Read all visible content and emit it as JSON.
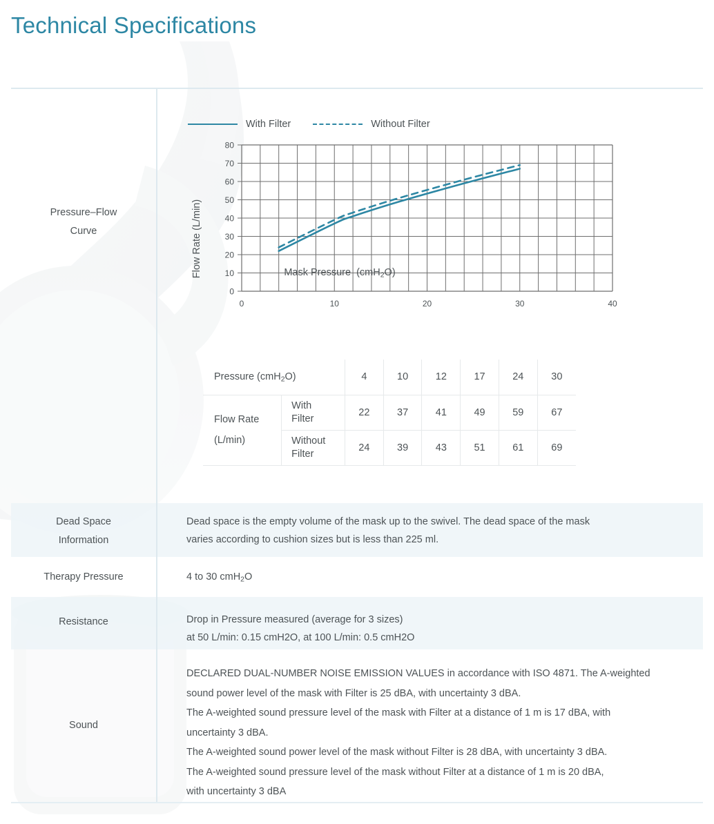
{
  "page": {
    "title": "Technical Specifications",
    "accent_color": "#2d87a4",
    "text_color": "#4d5356",
    "tint_color": "#edf4f8",
    "divider_color": "#dde9ef"
  },
  "chart_section": {
    "label_line1": "Pressure–Flow",
    "label_line2": "Curve"
  },
  "legend": {
    "with_filter": "With Filter",
    "without_filter": "Without Filter"
  },
  "chart_data": {
    "type": "line",
    "title": "",
    "xlabel": "Mask Pressure  (cmH₂O)",
    "ylabel": "Flow Rate (L/min)",
    "xlim": [
      0,
      40
    ],
    "ylim": [
      0,
      80
    ],
    "xticks": [
      0,
      10,
      20,
      30,
      40
    ],
    "xtick_labels": [
      "0",
      "10",
      "20",
      "30",
      "40"
    ],
    "yticks": [
      0,
      10,
      20,
      30,
      40,
      50,
      60,
      70,
      80
    ],
    "ytick_labels": [
      "0",
      "10",
      "20",
      "30",
      "40",
      "50",
      "60",
      "70",
      "80"
    ],
    "x_minor_step": 2,
    "grid": true,
    "legend_position": "above-plot",
    "x": [
      4,
      10,
      12,
      17,
      24,
      30
    ],
    "series": [
      {
        "name": "With Filter",
        "values": [
          22,
          37,
          41,
          49,
          59,
          67
        ],
        "style": "solid",
        "color": "#2d87a4"
      },
      {
        "name": "Without Filter",
        "values": [
          24,
          39,
          43,
          51,
          61,
          69
        ],
        "style": "dashed",
        "color": "#2d87a4"
      }
    ]
  },
  "spec_table": {
    "pressure_header": "Pressure (cmH₂O)",
    "pressure_values": [
      "4",
      "10",
      "12",
      "17",
      "24",
      "30"
    ],
    "flow_rate_label_line1": "Flow Rate",
    "flow_rate_label_line2": "(L/min)",
    "with_filter_label_line1": "With",
    "with_filter_label_line2": "Filter",
    "without_filter_label_line1": "Without",
    "without_filter_label_line2": "Filter",
    "with_filter_values": [
      "22",
      "37",
      "41",
      "49",
      "59",
      "67"
    ],
    "without_filter_values": [
      "24",
      "39",
      "43",
      "51",
      "61",
      "69"
    ]
  },
  "dead_space": {
    "label_line1": "Dead Space",
    "label_line2": "Information",
    "body_line1": "Dead space is the empty volume of the mask up to the swivel. The dead space of the mask",
    "body_line2": "varies according to cushion sizes but is less than 225 ml."
  },
  "therapy_pressure": {
    "label": "Therapy Pressure",
    "body_prefix": "4 to 30 cmH",
    "body_sub": "2",
    "body_suffix": "O"
  },
  "resistance": {
    "label": "Resistance",
    "body_line1": "Drop in Pressure measured (average for 3 sizes)",
    "body_line2": "at 50 L/min: 0.15 cmH2O, at 100 L/min: 0.5 cmH2O"
  },
  "sound": {
    "label": "Sound",
    "body_line1": "DECLARED DUAL-NUMBER NOISE EMISSION VALUES in accordance with ISO 4871. The A-weighted",
    "body_line2": "sound power level of the mask with Filter is 25 dBA, with uncertainty 3 dBA.",
    "body_line3": "The A-weighted sound pressure level of the mask with Filter at a distance of 1 m is 17 dBA, with",
    "body_line4": "uncertainty 3 dBA.",
    "body_line5": "The A-weighted sound power level of the mask without Filter is 28 dBA, with uncertainty 3 dBA.",
    "body_line6": "The A-weighted sound pressure level of the mask without Filter at a distance of 1 m is 20 dBA,",
    "body_line7": "with uncertainty 3 dBA"
  }
}
